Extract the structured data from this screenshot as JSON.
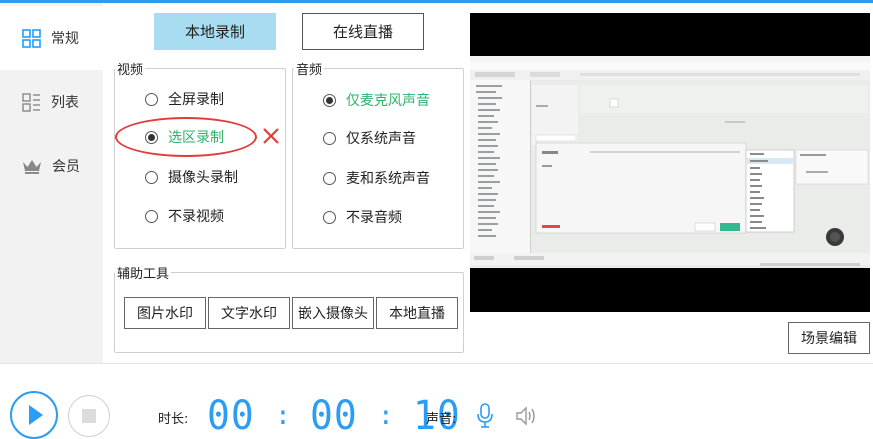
{
  "sidebar": {
    "items": [
      {
        "label": "常规",
        "icon": "grid-icon"
      },
      {
        "label": "列表",
        "icon": "list-icon"
      },
      {
        "label": "会员",
        "icon": "crown-icon"
      }
    ]
  },
  "tabs": {
    "local_record": "本地录制",
    "live_stream": "在线直播"
  },
  "video": {
    "title": "视频",
    "options": [
      "全屏录制",
      "选区录制",
      "摄像头录制",
      "不录视频"
    ],
    "selected": "选区录制"
  },
  "audio": {
    "title": "音频",
    "options": [
      "仅麦克风声音",
      "仅系统声音",
      "麦和系统声音",
      "不录音频"
    ],
    "selected": "仅麦克风声音"
  },
  "tools": {
    "title": "辅助工具",
    "buttons": [
      "图片水印",
      "文字水印",
      "嵌入摄像头",
      "本地直播"
    ]
  },
  "preview": {
    "scene_edit": "场景编辑"
  },
  "bottom": {
    "duration_label": "时长:",
    "timer": {
      "h": "00",
      "m": "00",
      "s": "10"
    },
    "sound_label": "声音:"
  },
  "colors": {
    "accent": "#2a9df4",
    "active_tab": "#a8dcf0",
    "annotation": "#e23b3b",
    "selected_audio": "#2fb26a"
  }
}
